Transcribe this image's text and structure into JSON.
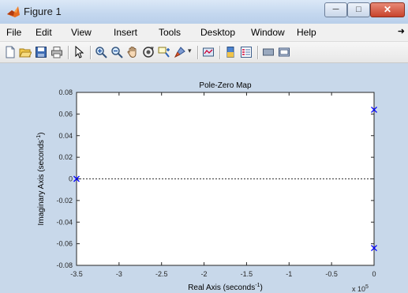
{
  "window": {
    "title": "Figure 1"
  },
  "menu": [
    "File",
    "Edit",
    "View",
    "Insert",
    "Tools",
    "Desktop",
    "Window",
    "Help"
  ],
  "chart_data": {
    "type": "scatter",
    "title": "Pole-Zero Map",
    "xlabel": "Real Axis (seconds",
    "xlabel_sup": "-1",
    "xlabel_tail": ")",
    "ylabel": "Imaginary Axis (seconds",
    "ylabel_sup": "-1",
    "ylabel_tail": ")",
    "xlim": [
      -3.5,
      0
    ],
    "ylim": [
      -0.08,
      0.08
    ],
    "x_multiplier_base": "x 10",
    "x_multiplier_exp": "5",
    "x_ticks": [
      "-3.5",
      "-3",
      "-2.5",
      "-2",
      "-1.5",
      "-1",
      "-0.5",
      "0"
    ],
    "x_tick_values": [
      -3.5,
      -3,
      -2.5,
      -2,
      -1.5,
      -1,
      -0.5,
      0
    ],
    "y_ticks": [
      "0.08",
      "0.06",
      "0.04",
      "0.02",
      "0",
      "-0.02",
      "-0.04",
      "-0.06",
      "-0.08"
    ],
    "y_tick_values": [
      0.08,
      0.06,
      0.04,
      0.02,
      0,
      -0.02,
      -0.04,
      -0.06,
      -0.08
    ],
    "grid": false,
    "series": [
      {
        "type": "poles",
        "marker": "x",
        "color": "#0000ff",
        "points": [
          {
            "x": -3.5,
            "y": 0
          },
          {
            "x": 0,
            "y": 0.064
          },
          {
            "x": 0,
            "y": -0.064
          }
        ]
      }
    ]
  }
}
